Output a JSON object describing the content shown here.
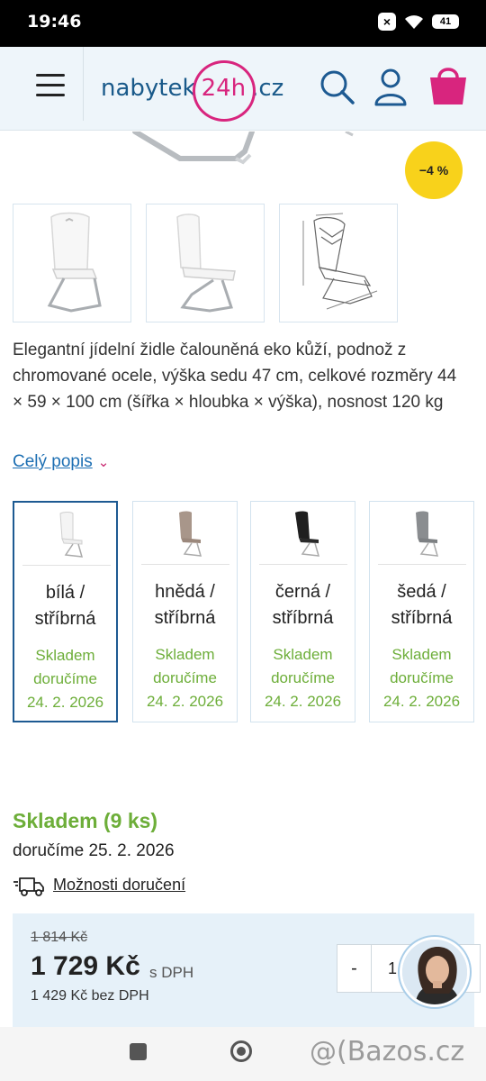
{
  "status_bar": {
    "time": "19:46",
    "battery": "41"
  },
  "header": {
    "logo_text_left": "nabytek",
    "logo_text_ring": "24h",
    "logo_text_right": ".cz",
    "icons": [
      "menu-icon",
      "search-icon",
      "user-icon",
      "cart-icon"
    ]
  },
  "product": {
    "discount_badge": "−4 %",
    "thumbnails": [
      "chair-white-front",
      "chair-white-side",
      "chair-dimensions-drawing"
    ],
    "description": "Elegantní jídelní židle čalouněná eko kůží, podnož z chromované ocele, výška sedu 47 cm, celkové rozměry 44 × 59 × 100 cm (šířka × hloubka × výška), nosnost 120 kg",
    "full_description_link": "Celý popis"
  },
  "variants": [
    {
      "name_line1": "bílá /",
      "name_line2": "stříbrná",
      "stock_line1": "Skladem",
      "stock_line2": "doručíme",
      "stock_line3": "24. 2. 2026",
      "selected": true,
      "chair_color": "#f4f4f4"
    },
    {
      "name_line1": "hnědá /",
      "name_line2": "stříbrná",
      "stock_line1": "Skladem",
      "stock_line2": "doručíme",
      "stock_line3": "24. 2. 2026",
      "selected": false,
      "chair_color": "#a8968a"
    },
    {
      "name_line1": "černá /",
      "name_line2": "stříbrná",
      "stock_line1": "Skladem",
      "stock_line2": "doručíme",
      "stock_line3": "24. 2. 2026",
      "selected": false,
      "chair_color": "#1f1f1f"
    },
    {
      "name_line1": "šedá /",
      "name_line2": "stříbrná",
      "stock_line1": "Skladem",
      "stock_line2": "doručíme",
      "stock_line3": "24. 2. 2026",
      "selected": false,
      "chair_color": "#8a8d90"
    }
  ],
  "availability": {
    "title": "Skladem",
    "count": "(9 ks)",
    "delivery_date": "doručíme 25. 2. 2026",
    "delivery_options_link": "Možnosti doručení"
  },
  "pricing": {
    "old_price": "1 814 Kč",
    "price": "1 729 Kč",
    "vat_label": "s DPH",
    "price_without_vat": "1 429 Kč bez DPH",
    "minus_label": "-",
    "quantity": "1"
  },
  "watermark": "@(Bazos.cz",
  "colors": {
    "accent_blue": "#1d5a92",
    "stock_green": "#6dae39",
    "brand_pink": "#d8257e",
    "discount_yellow": "#f8d21b"
  }
}
